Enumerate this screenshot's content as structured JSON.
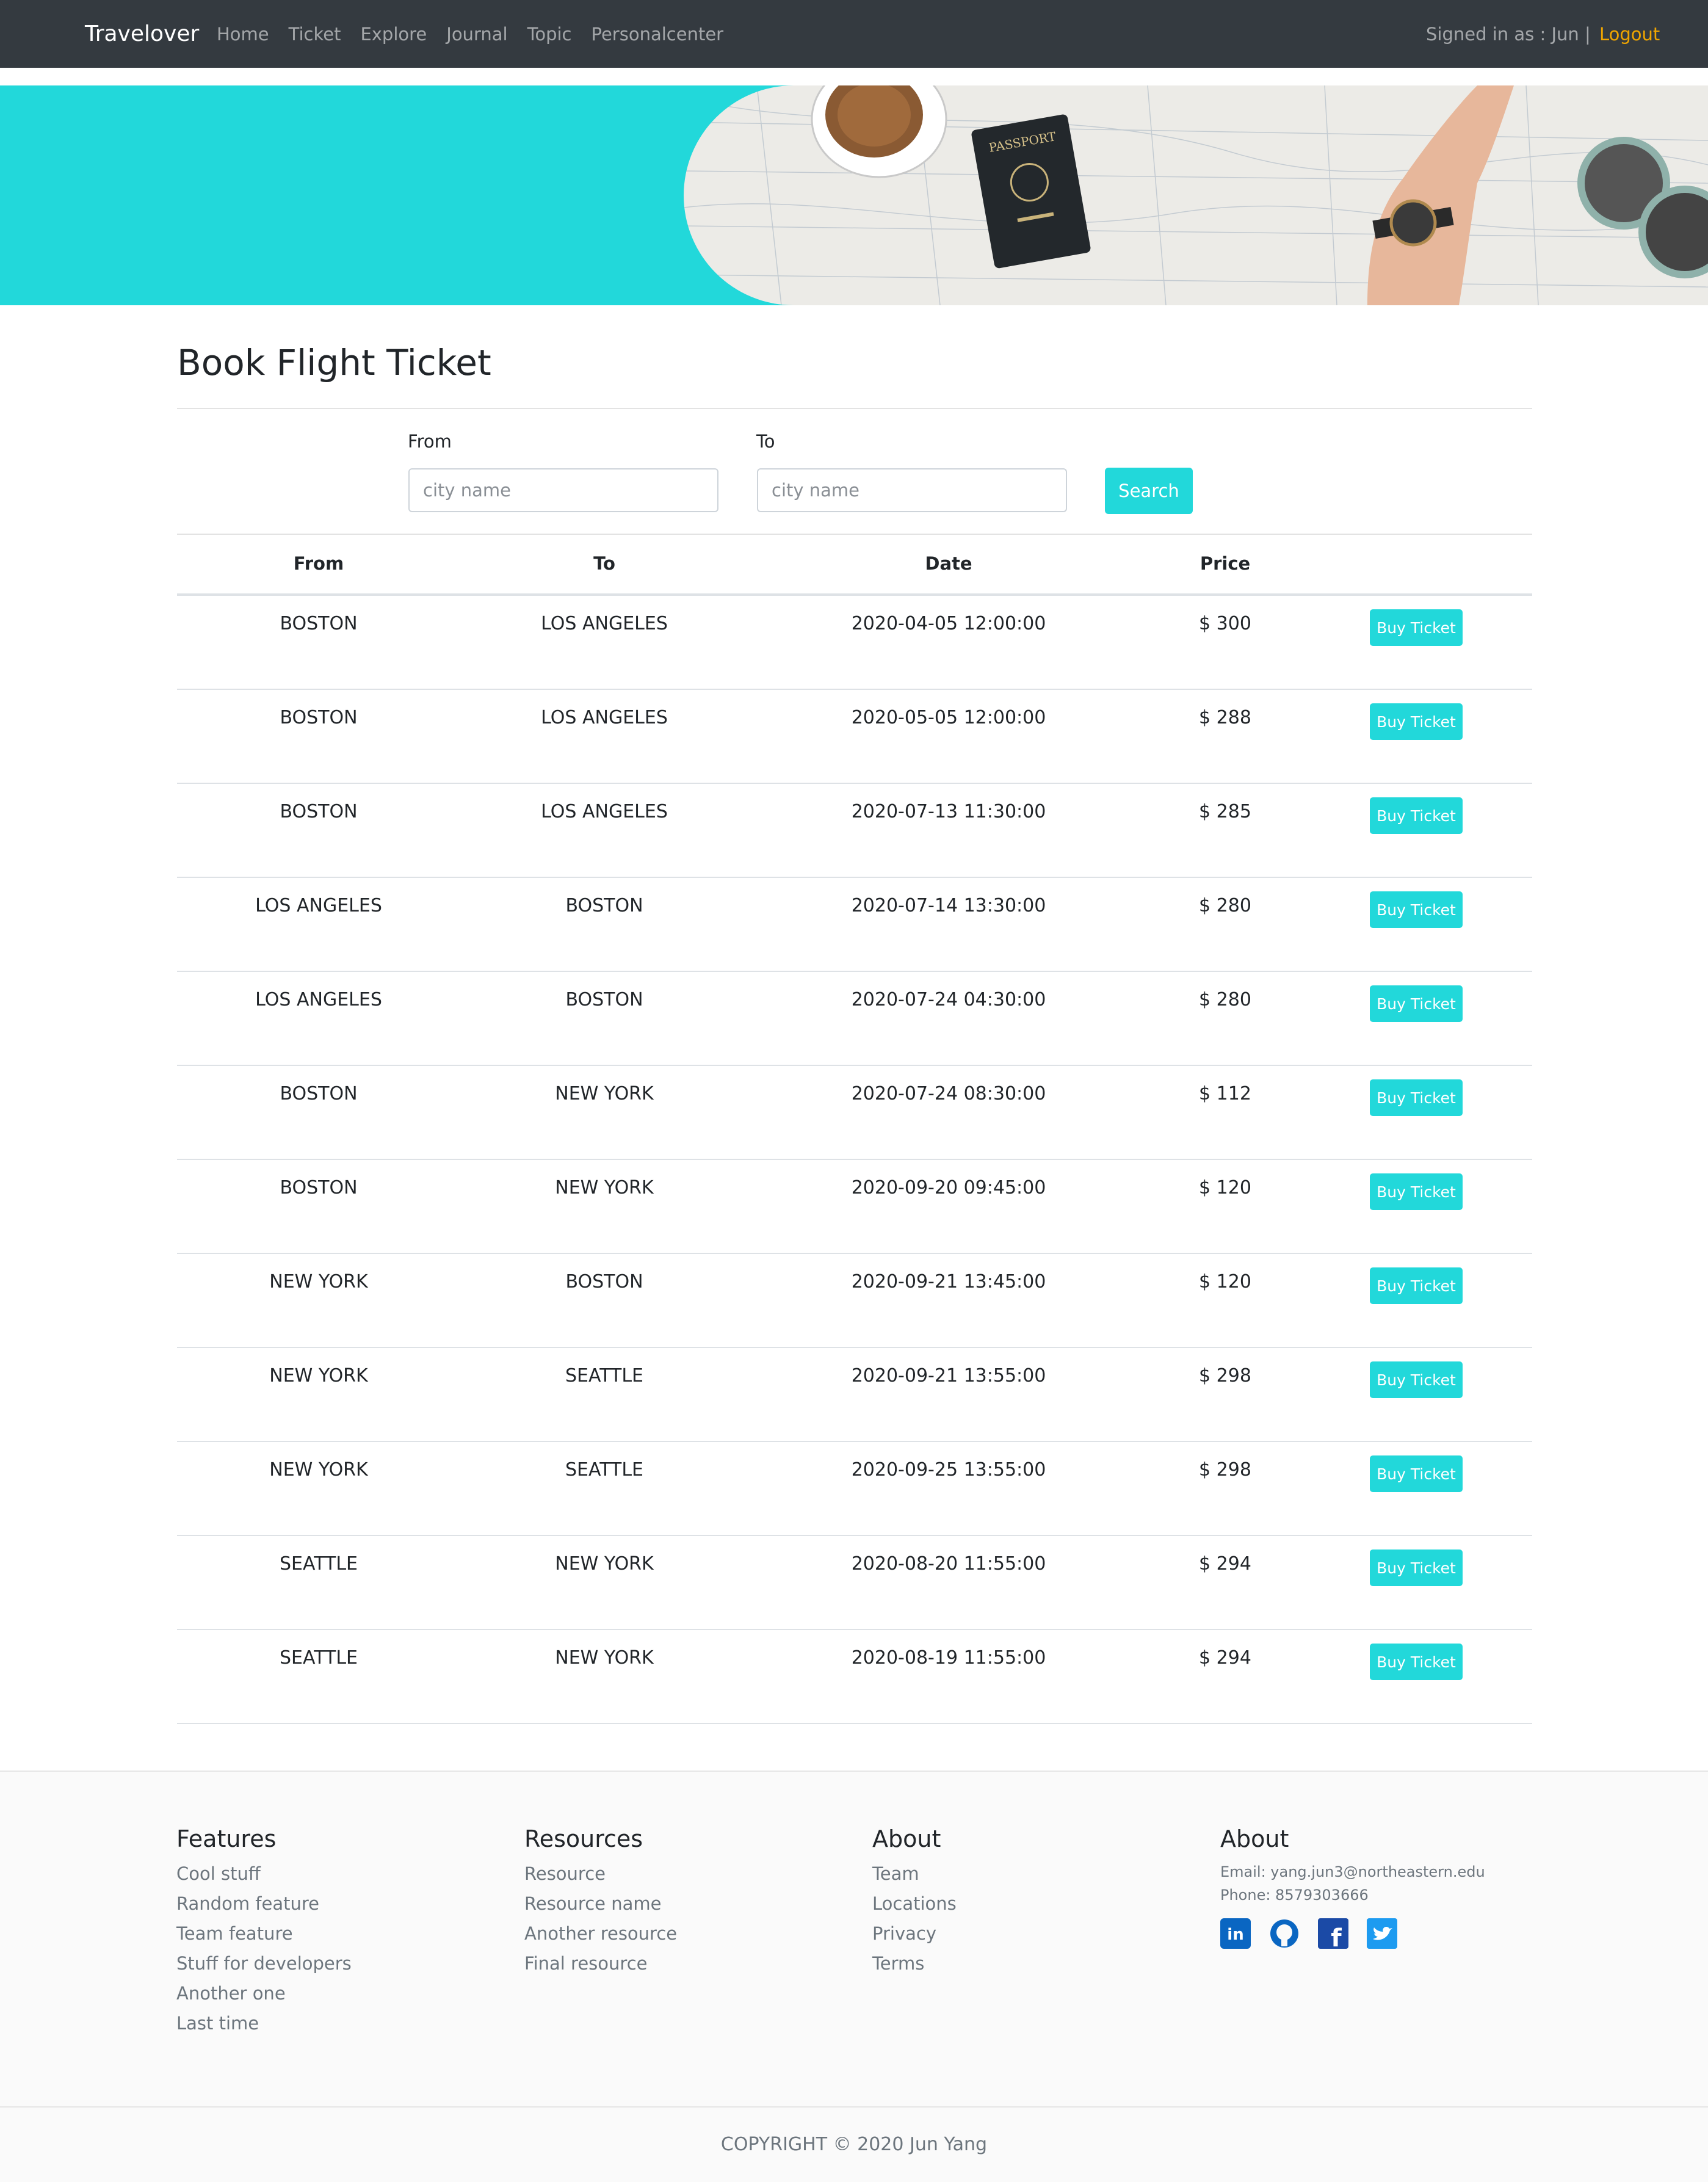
{
  "nav": {
    "brand": "Travelover",
    "links": [
      "Home",
      "Ticket",
      "Explore",
      "Journal",
      "Topic",
      "Personalcenter"
    ],
    "signed_in": "Signed in as : Jun |",
    "logout": "Logout"
  },
  "banner": {
    "passport_text": "PASSPORT"
  },
  "search": {
    "title": "Book Flight Ticket",
    "from_label": "From",
    "to_label": "To",
    "from_placeholder": "city name",
    "to_placeholder": "city name",
    "search_button": "Search"
  },
  "table": {
    "headers": [
      "From",
      "To",
      "Date",
      "Price"
    ],
    "buy_label": "Buy Ticket",
    "rows": [
      {
        "from": "BOSTON",
        "to": "LOS ANGELES",
        "date": "2020-04-05 12:00:00",
        "price": "$ 300"
      },
      {
        "from": "BOSTON",
        "to": "LOS ANGELES",
        "date": "2020-05-05 12:00:00",
        "price": "$ 288"
      },
      {
        "from": "BOSTON",
        "to": "LOS ANGELES",
        "date": "2020-07-13 11:30:00",
        "price": "$ 285"
      },
      {
        "from": "LOS ANGELES",
        "to": "BOSTON",
        "date": "2020-07-14 13:30:00",
        "price": "$ 280"
      },
      {
        "from": "LOS ANGELES",
        "to": "BOSTON",
        "date": "2020-07-24 04:30:00",
        "price": "$ 280"
      },
      {
        "from": "BOSTON",
        "to": "NEW YORK",
        "date": "2020-07-24 08:30:00",
        "price": "$ 112"
      },
      {
        "from": "BOSTON",
        "to": "NEW YORK",
        "date": "2020-09-20 09:45:00",
        "price": "$ 120"
      },
      {
        "from": "NEW YORK",
        "to": "BOSTON",
        "date": "2020-09-21 13:45:00",
        "price": "$ 120"
      },
      {
        "from": "NEW YORK",
        "to": "SEATTLE",
        "date": "2020-09-21 13:55:00",
        "price": "$ 298"
      },
      {
        "from": "NEW YORK",
        "to": "SEATTLE",
        "date": "2020-09-25 13:55:00",
        "price": "$ 298"
      },
      {
        "from": "SEATTLE",
        "to": "NEW YORK",
        "date": "2020-08-20 11:55:00",
        "price": "$ 294"
      },
      {
        "from": "SEATTLE",
        "to": "NEW YORK",
        "date": "2020-08-19 11:55:00",
        "price": "$ 294"
      }
    ]
  },
  "footer": {
    "features": {
      "title": "Features",
      "items": [
        "Cool stuff",
        "Random feature",
        "Team feature",
        "Stuff for developers",
        "Another one",
        "Last time"
      ]
    },
    "resources": {
      "title": "Resources",
      "items": [
        "Resource",
        "Resource name",
        "Another resource",
        "Final resource"
      ]
    },
    "about": {
      "title": "About",
      "items": [
        "Team",
        "Locations",
        "Privacy",
        "Terms"
      ]
    },
    "contact": {
      "title": "About",
      "email": "Email: yang.jun3@northeastern.edu",
      "phone": "Phone: 8579303666"
    },
    "social_icons": [
      "linkedin-icon",
      "github-icon",
      "facebook-icon",
      "twitter-icon"
    ],
    "copyright": "COPYRIGHT © 2020 Jun Yang"
  }
}
